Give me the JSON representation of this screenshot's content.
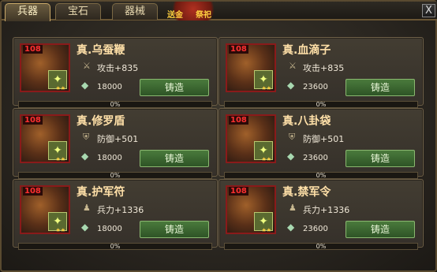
{
  "tabs": [
    {
      "label": "兵器"
    },
    {
      "label": "宝石"
    },
    {
      "label": "器械"
    }
  ],
  "deco": {
    "left": "送金",
    "right": "祭祀"
  },
  "close_label": "X",
  "cards": [
    {
      "level": "108",
      "name": "真.乌蚕鞭",
      "stat": "攻击+835",
      "price": "18000",
      "button": "铸造",
      "progress": "0%"
    },
    {
      "level": "108",
      "name": "真.血滴子",
      "stat": "攻击+835",
      "price": "23600",
      "button": "铸造",
      "progress": "0%"
    },
    {
      "level": "108",
      "name": "真.修罗盾",
      "stat": "防御+501",
      "price": "18000",
      "button": "铸造",
      "progress": "0%"
    },
    {
      "level": "108",
      "name": "真.八卦袋",
      "stat": "防御+501",
      "price": "23600",
      "button": "铸造",
      "progress": "0%"
    },
    {
      "level": "108",
      "name": "真.护军符",
      "stat": "兵力+1336",
      "price": "18000",
      "button": "铸造",
      "progress": "0%"
    },
    {
      "level": "108",
      "name": "真.禁军令",
      "stat": "兵力+1336",
      "price": "23600",
      "button": "铸造",
      "progress": "0%"
    }
  ]
}
